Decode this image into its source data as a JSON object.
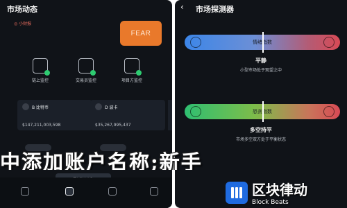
{
  "left": {
    "title": "市场动态",
    "sub_label": "◎ 小财报",
    "fear_label": "FEAR",
    "features": [
      {
        "label": "链上监控"
      },
      {
        "label": "交易员监控"
      },
      {
        "label": "项目方监控"
      }
    ],
    "coins": [
      {
        "name": "B 比特币",
        "value": "$147,211,003,598"
      },
      {
        "name": "D 波卡",
        "value": "$35,267,995,437"
      }
    ],
    "nav_popup": "添加账户名称"
  },
  "right": {
    "back_icon": "‹",
    "title": "市场探测器",
    "gauge1": {
      "label": "情绪指数",
      "marker_pos": 0.5
    },
    "status1": "平静",
    "desc1": "小型市场处于观望之中",
    "gauge2": {
      "label": "恐贪指数",
      "marker_pos": 0.5
    },
    "status2": "多空持平",
    "desc2": "市场多空双方处于平衡状态"
  },
  "overlay_text": "中添加账户名称;新手",
  "brand": {
    "zh": "区块律动",
    "en": "Block Beats"
  },
  "colors": {
    "fear": "#e9792b",
    "gauge_blue_start": "#3c86e8",
    "gauge_green_start": "#2fbf71",
    "gauge_red_end": "#d84a55",
    "brand_blue": "#1f6be0"
  }
}
